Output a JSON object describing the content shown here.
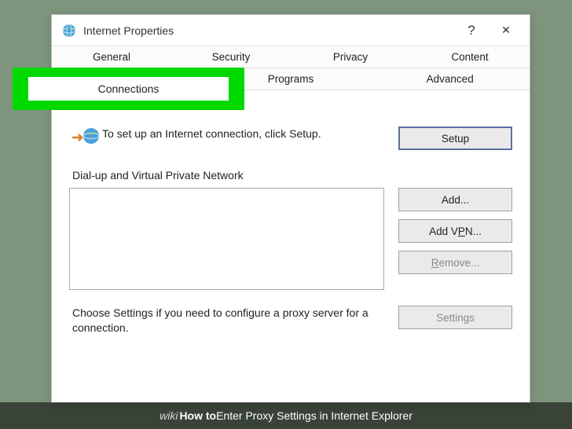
{
  "titlebar": {
    "title": "Internet Properties",
    "help_glyph": "?",
    "close_glyph": "✕"
  },
  "tabs": {
    "row1": [
      "General",
      "Security",
      "Privacy",
      "Content"
    ],
    "row2": [
      "Connections",
      "Programs",
      "Advanced"
    ],
    "active": "Connections"
  },
  "setup": {
    "text": "To set up an Internet connection, click Setup.",
    "button": "Setup"
  },
  "dialup": {
    "label": "Dial-up and Virtual Private Network",
    "add": "Add...",
    "add_vpn_pre": "Add V",
    "add_vpn_u": "P",
    "add_vpn_post": "N...",
    "remove_u": "R",
    "remove_post": "emove..."
  },
  "proxy": {
    "text": "Choose Settings if you need to configure a proxy server for a connection.",
    "button": "Settings"
  },
  "caption": {
    "pre": "wiki",
    "how": "How to ",
    "rest": "Enter Proxy Settings in Internet Explorer"
  }
}
